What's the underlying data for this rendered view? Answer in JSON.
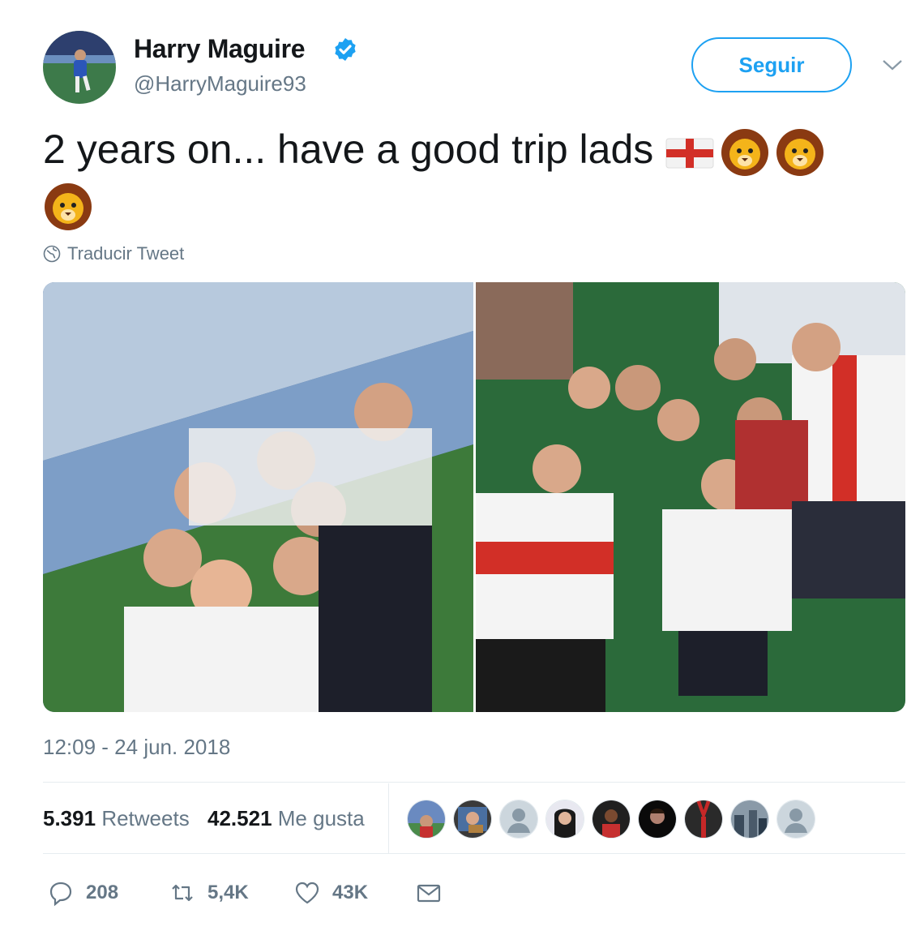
{
  "user": {
    "name": "Harry Maguire",
    "handle": "@HarryMaguire93",
    "verified": true
  },
  "follow_button": "Seguir",
  "tweet": {
    "text": "2 years on... have a good trip lads",
    "emojis": [
      "england-flag-emoji",
      "lion-face-emoji",
      "lion-face-emoji",
      "lion-face-emoji"
    ]
  },
  "translate_label": "Traducir Tweet",
  "media": [
    "stadium-group-selfie-photo",
    "stands-group-photo"
  ],
  "timestamp": "12:09 - 24 jun. 2018",
  "stats": {
    "retweets_count": "5.391",
    "retweets_label": "Retweets",
    "likes_count": "42.521",
    "likes_label": "Me gusta"
  },
  "actions": {
    "replies": "208",
    "retweets": "5,4K",
    "likes": "43K"
  },
  "colors": {
    "accent": "#1da1f2",
    "secondary_text": "#657786",
    "primary_text": "#14171a"
  }
}
